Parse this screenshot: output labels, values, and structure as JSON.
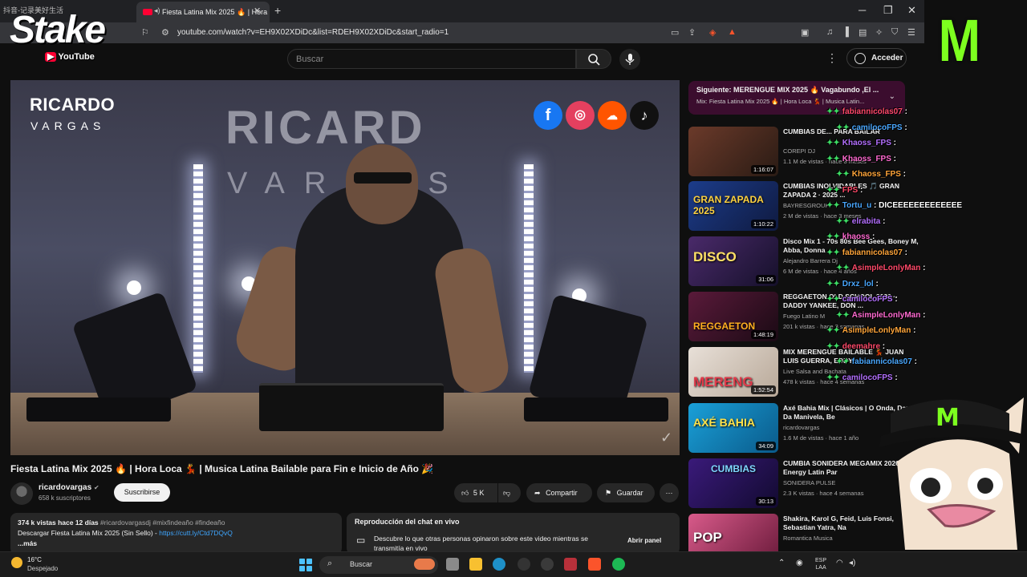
{
  "browser": {
    "prev_tab_label": "抖音-记录美好生活",
    "active_tab_title": "Fiesta Latina Mix 2025 🔥 | Hora",
    "url": "youtube.com/watch?v=EH9X02XDiDc&list=RDEH9X02XDiDc&start_radio=1"
  },
  "youtube": {
    "search_placeholder": "Buscar",
    "sign_in_label": "Acceder",
    "video": {
      "brand_line1": "RICARDO",
      "brand_line2": "VARGAS",
      "bg_line1": "RICARD",
      "bg_line2": "VARGAS",
      "title": "Fiesta Latina Mix 2025 🔥 | Hora Loca 💃 | Musica Latina Bailable para Fin e Inicio de Año 🎉",
      "social_icons": [
        "facebook-icon",
        "instagram-icon",
        "soundcloud-icon",
        "tiktok-icon"
      ]
    },
    "channel": {
      "name": "ricardovargas",
      "subscribers": "658 k suscriptores",
      "subscribe_label": "Suscribirse"
    },
    "actions": {
      "likes": "5 K",
      "share_label": "Compartir",
      "save_label": "Guardar"
    },
    "description": {
      "stats": "374 k vistas  hace 12 días",
      "hashtags": "#ricardovargasdj #mixfindeaño #findeaño",
      "line2_prefix": "Descargar Fiesta Latina Mix 2025 (Sin Sello) - ",
      "link": "https://cutt.ly/Ctd7DQvQ",
      "more": "...más"
    },
    "chat_replay": {
      "title": "Reproducción del chat en vivo",
      "text": "Descubre lo que otras personas opinaron sobre este video mientras se transmitía en vivo",
      "button": "Abrir panel"
    },
    "up_next": {
      "title": "Siguiente: MERENGUE MIX 2025 🔥 Vagabundo ,El ...",
      "subtitle": "Mix: Fiesta Latina Mix 2025 🔥 | Hora Loca 💃 | Musica Latin..."
    },
    "recommendations": [
      {
        "title": "CUMBIAS DE... PARA BAILAR",
        "channel": "COREPI DJ",
        "meta": "1.1 M de vistas · hace 8 meses",
        "duration": "1:16:07",
        "thumb_text": ""
      },
      {
        "title": "CUMBIAS INOLVIDABLES 🎵 GRAN ZAPADA 2 · 2025 ...",
        "channel": "BAYRESGROUP",
        "meta": "2 M de vistas · hace 3 meses",
        "duration": "1:10:22",
        "thumb_text": "GRAN ZAPADA 2025"
      },
      {
        "title": "Disco Mix 1 - 70s 80s Bee Gees, Boney M, Abba, Donna",
        "channel": "Alejandro Barrera Dj",
        "meta": "6 M de vistas · hace 4 años",
        "duration": "31:06",
        "thumb_text": "DISCO"
      },
      {
        "title": "REGGAETON OLD SCHOOL 2026 ~ DADDY YANKEE, DON ...",
        "channel": "Fuego Latino M",
        "meta": "201 k vistas · hace 3 semanas",
        "duration": "1:48:19",
        "thumb_text": "REGGAETON"
      },
      {
        "title": "MIX MERENGUE BAILABLE 💃 JUAN LUIS GUERRA, EDDY",
        "channel": "Live Salsa and Bachata",
        "meta": "478 k vistas · hace 4 semanas",
        "duration": "1:52:54",
        "thumb_text": "MERENG"
      },
      {
        "title": "Axé Bahia Mix | Clásicos | O Onda, Danza Da Manivela, Be",
        "channel": "ricardovargas",
        "meta": "1.6 M de vistas · hace 1 año",
        "duration": "34:09",
        "thumb_text": "AXÉ BAHIA"
      },
      {
        "title": "CUMBIA SONIDERA MEGAMIX 2026 High Energy Latin Par",
        "channel": "SONIDERA PULSE",
        "meta": "2.3 K vistas · hace 4 semanas",
        "duration": "30:13",
        "thumb_text": "CUMBIAS"
      },
      {
        "title": "Shakira, Karol G, Feid, Luis Fonsi, Sebastian Yatra, Na",
        "channel": "Romantica Musica",
        "meta": "",
        "duration": "",
        "thumb_text": "POP"
      }
    ]
  },
  "overlay": {
    "stake_logo": "Stake",
    "yt_label": "YouTube",
    "chat": [
      {
        "user": "fabiannicolas07",
        "msg": ":"
      },
      {
        "user": "camilocoFPS",
        "msg": ":"
      },
      {
        "user": "Khaoss_FPS",
        "msg": ":"
      },
      {
        "user": "Khaoss_FPS",
        "msg": ":"
      },
      {
        "user": "Khaoss_FPS",
        "msg": ":"
      },
      {
        "user": "FPS",
        "msg": ":"
      },
      {
        "user": "Tortu_u",
        "msg": ": DICEEEEEEEEEEEEE"
      },
      {
        "user": "elrabita",
        "msg": ":"
      },
      {
        "user": "khaoss",
        "msg": ":"
      },
      {
        "user": "fabiannicolas07",
        "msg": ":"
      },
      {
        "user": "AsimpleLonlyMan",
        "msg": ":"
      },
      {
        "user": "Drxz_lol",
        "msg": ":"
      },
      {
        "user": "camilocoFPS",
        "msg": ":"
      },
      {
        "user": "AsimpleLonlyMan",
        "msg": ":"
      },
      {
        "user": "AsimpleLonlyMan",
        "msg": ":"
      },
      {
        "user": "deemahre",
        "msg": ":"
      },
      {
        "user": "fabiannicolas07",
        "msg": ":"
      },
      {
        "user": "camilocoFPS",
        "msg": ":"
      }
    ]
  },
  "taskbar": {
    "temp": "16°C",
    "weather": "Despejado",
    "search_label": "Buscar",
    "lang_line1": "ESP",
    "lang_line2": "LAA"
  }
}
